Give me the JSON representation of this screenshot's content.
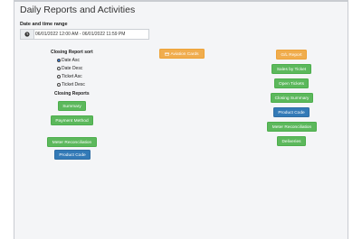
{
  "page": {
    "title": "Daily Reports and Activities"
  },
  "date_range": {
    "label": "Date and time range",
    "value": "06/01/2022 12:00 AM - 06/01/2022 11:59 PM"
  },
  "sort": {
    "heading": "Closing Report sort",
    "options": [
      {
        "label": "Date Asc",
        "checked": true
      },
      {
        "label": "Date Desc",
        "checked": false
      },
      {
        "label": "Ticket Asc",
        "checked": false
      },
      {
        "label": "Ticket Desc",
        "checked": false
      }
    ]
  },
  "closing_reports": {
    "heading": "Closing Reports",
    "summary": "Summary",
    "payment_method": "Payment Method",
    "meter_reconciliation": "Meter Reconciliation",
    "product_code": "Product Code"
  },
  "middle": {
    "aviation_cards": "Aviation Cards"
  },
  "right": {
    "gl_report": "G/L Report",
    "sales_by_ticket": "Sales by Ticket",
    "open_tickets": "Open Tickets",
    "closing_summary": "Closing Summary",
    "product_code": "Product Code",
    "meter_reconciliation": "Meter Reconciliation",
    "deliveries": "Deliveries"
  },
  "colors": {
    "green": "#5cb85c",
    "blue": "#337ab7",
    "orange": "#f0ad4e"
  }
}
